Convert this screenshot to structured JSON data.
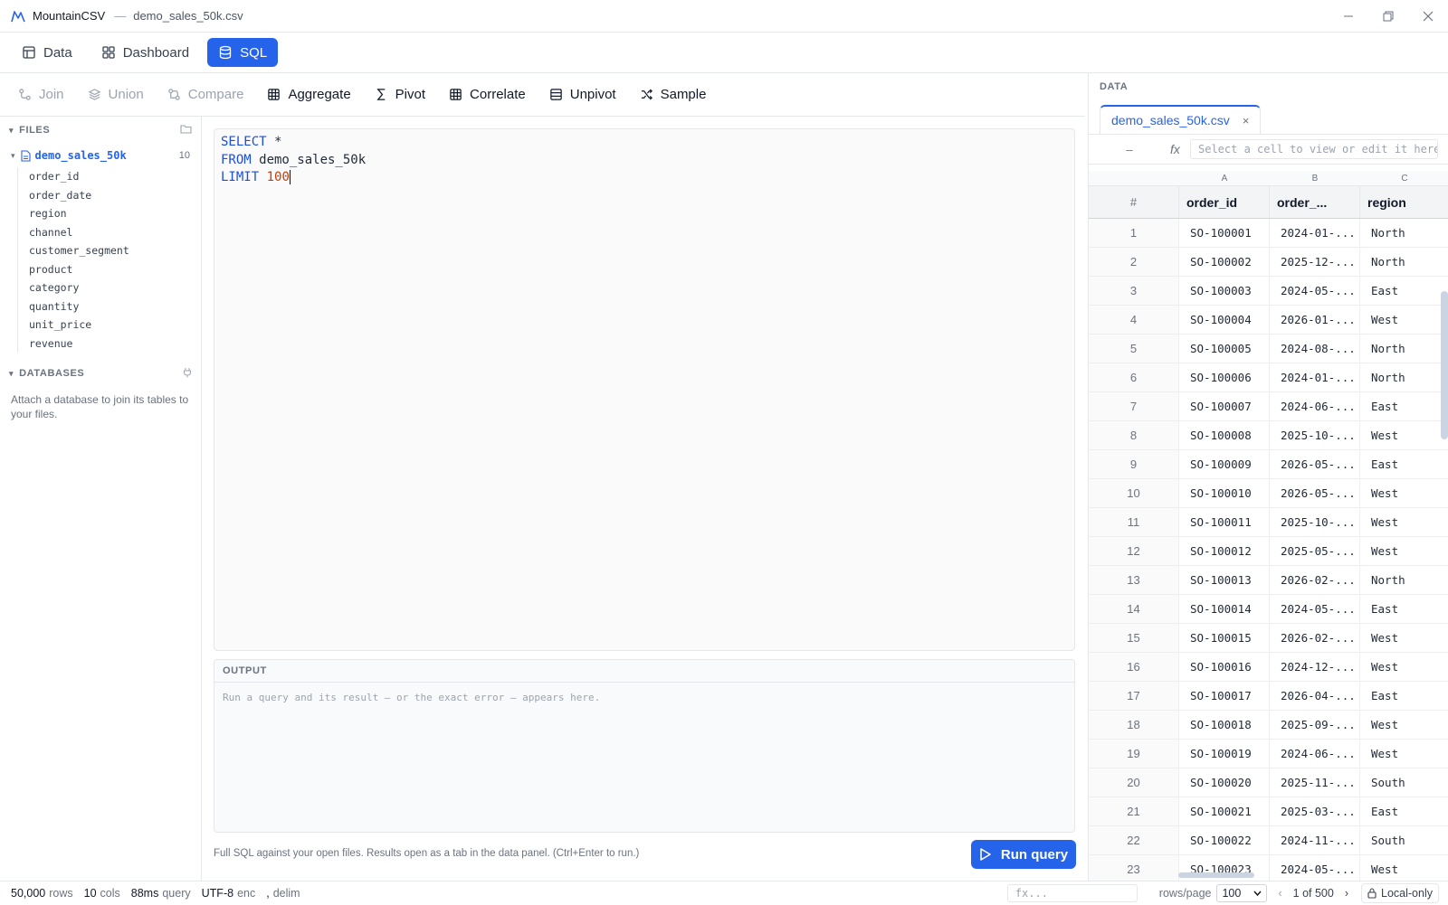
{
  "titlebar": {
    "app_name": "MountainCSV",
    "separator": "—",
    "file_title": "demo_sales_50k.csv"
  },
  "main_tabs": [
    {
      "label": "Data",
      "icon": "table-icon",
      "active": false
    },
    {
      "label": "Dashboard",
      "icon": "dashboard-icon",
      "active": false
    },
    {
      "label": "SQL",
      "icon": "database-icon",
      "active": true
    }
  ],
  "toolbar": [
    {
      "label": "Join",
      "icon": "join-icon",
      "enabled": false
    },
    {
      "label": "Union",
      "icon": "layers-icon",
      "enabled": false
    },
    {
      "label": "Compare",
      "icon": "compare-icon",
      "enabled": false
    },
    {
      "label": "Aggregate",
      "icon": "grid-icon",
      "enabled": true
    },
    {
      "label": "Pivot",
      "icon": "sigma-icon",
      "enabled": true
    },
    {
      "label": "Correlate",
      "icon": "grid-icon",
      "enabled": true
    },
    {
      "label": "Unpivot",
      "icon": "rows-icon",
      "enabled": true
    },
    {
      "label": "Sample",
      "icon": "shuffle-icon",
      "enabled": true
    }
  ],
  "sidebar": {
    "files_heading": "FILES",
    "file": {
      "name": "demo_sales_50k",
      "count": "10"
    },
    "columns": [
      "order_id",
      "order_date",
      "region",
      "channel",
      "customer_segment",
      "product",
      "category",
      "quantity",
      "unit_price",
      "revenue"
    ],
    "databases_heading": "DATABASES",
    "databases_hint": "Attach a database to join its tables to your files."
  },
  "editor": {
    "line1_kw": "SELECT",
    "line1_rest": " *",
    "line2_kw": "FROM",
    "line2_rest": " demo_sales_50k",
    "line3_kw": "LIMIT",
    "line3_num": " 100"
  },
  "output": {
    "heading": "OUTPUT",
    "placeholder": "Run a query and its result — or the exact error — appears here."
  },
  "hint": "Full SQL against your open files. Results open as a tab in the data panel. (Ctrl+Enter to run.)",
  "run_button": "Run query",
  "data_panel": {
    "heading": "DATA",
    "tab_label": "demo_sales_50k.csv",
    "tab_close": "×",
    "cell_ref": "–",
    "fx_label": "fx",
    "fx_placeholder": "Select a cell to view or edit it here",
    "col_letters": [
      "A",
      "B",
      "C"
    ],
    "headers": [
      "#",
      "order_id",
      "order_...",
      "region"
    ],
    "rows": [
      [
        "1",
        "SO-100001",
        "2024-01-...",
        "North"
      ],
      [
        "2",
        "SO-100002",
        "2025-12-...",
        "North"
      ],
      [
        "3",
        "SO-100003",
        "2024-05-...",
        "East"
      ],
      [
        "4",
        "SO-100004",
        "2026-01-...",
        "West"
      ],
      [
        "5",
        "SO-100005",
        "2024-08-...",
        "North"
      ],
      [
        "6",
        "SO-100006",
        "2024-01-...",
        "North"
      ],
      [
        "7",
        "SO-100007",
        "2024-06-...",
        "East"
      ],
      [
        "8",
        "SO-100008",
        "2025-10-...",
        "West"
      ],
      [
        "9",
        "SO-100009",
        "2026-05-...",
        "East"
      ],
      [
        "10",
        "SO-100010",
        "2026-05-...",
        "West"
      ],
      [
        "11",
        "SO-100011",
        "2025-10-...",
        "West"
      ],
      [
        "12",
        "SO-100012",
        "2025-05-...",
        "West"
      ],
      [
        "13",
        "SO-100013",
        "2026-02-...",
        "North"
      ],
      [
        "14",
        "SO-100014",
        "2024-05-...",
        "East"
      ],
      [
        "15",
        "SO-100015",
        "2026-02-...",
        "West"
      ],
      [
        "16",
        "SO-100016",
        "2024-12-...",
        "West"
      ],
      [
        "17",
        "SO-100017",
        "2026-04-...",
        "East"
      ],
      [
        "18",
        "SO-100018",
        "2025-09-...",
        "West"
      ],
      [
        "19",
        "SO-100019",
        "2024-06-...",
        "West"
      ],
      [
        "20",
        "SO-100020",
        "2025-11-...",
        "South"
      ],
      [
        "21",
        "SO-100021",
        "2025-03-...",
        "East"
      ],
      [
        "22",
        "SO-100022",
        "2024-11-...",
        "South"
      ],
      [
        "23",
        "SO-100023",
        "2024-05-...",
        "West"
      ]
    ]
  },
  "statusbar": {
    "rows_value": "50,000",
    "rows_label": "rows",
    "cols_value": "10",
    "cols_label": "cols",
    "query_value": "88ms",
    "query_label": "query",
    "enc_value": "UTF-8",
    "enc_label": "enc",
    "delim_value": ",",
    "delim_label": "delim",
    "filter_placeholder": "fx...",
    "rows_per_page_label": "rows/page",
    "rows_per_page_value": "100",
    "page_label": "1 of 500",
    "local_badge": "Local-only"
  },
  "colors": {
    "accent": "#2563eb",
    "keyword": "#1d4ed8",
    "number": "#c2410c"
  }
}
